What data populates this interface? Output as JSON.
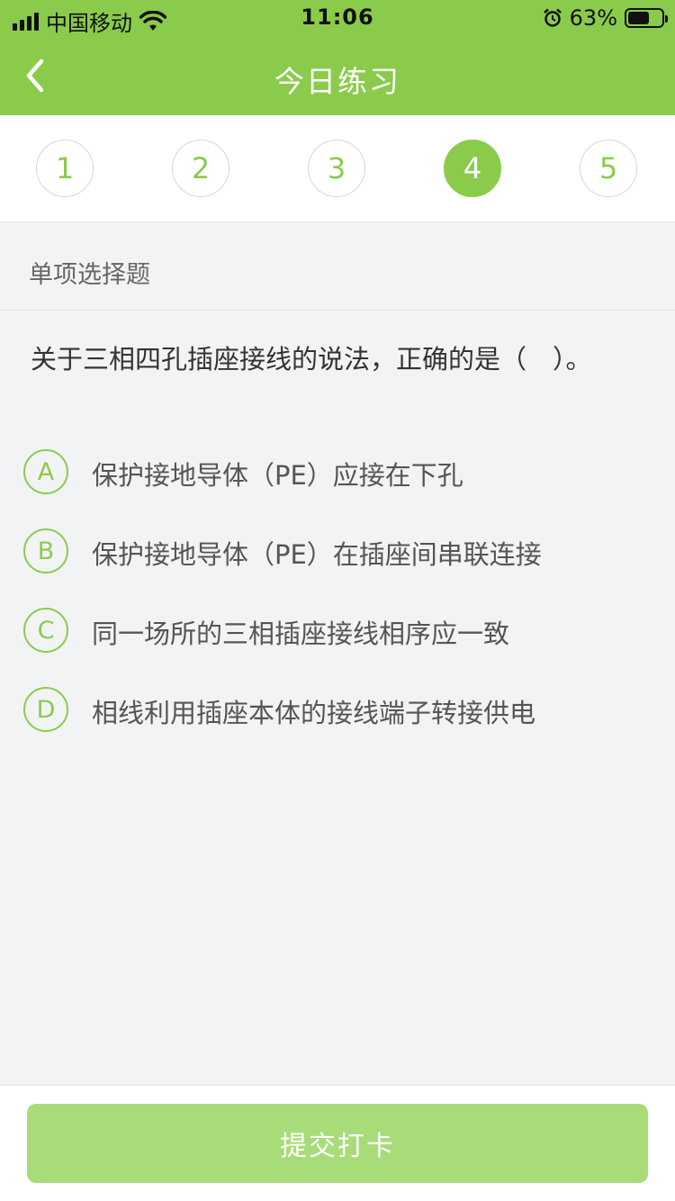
{
  "status_bar": {
    "carrier": "中国移动",
    "time": "11:06",
    "battery": "63%",
    "battery_level": 63,
    "icons": [
      "signal-icon",
      "wifi-icon",
      "alarm-icon",
      "battery-icon"
    ]
  },
  "nav": {
    "title": "今日练习",
    "back_icon": "chevron-left-icon"
  },
  "steps": {
    "items": [
      "1",
      "2",
      "3",
      "4",
      "5"
    ],
    "active": "4"
  },
  "question": {
    "type_label": "单项选择题",
    "text": "关于三相四孔插座接线的说法，正确的是（　）。",
    "options": [
      {
        "letter": "A",
        "text": "保护接地导体（PE）应接在下孔"
      },
      {
        "letter": "B",
        "text": "保护接地导体（PE）在插座间串联连接"
      },
      {
        "letter": "C",
        "text": "同一场所的三相插座接线相序应一致"
      },
      {
        "letter": "D",
        "text": "相线利用插座本体的接线端子转接供电"
      }
    ]
  },
  "footer": {
    "submit_label": "提交打卡"
  },
  "colors": {
    "brand_green": "#8bcb4b",
    "submit_button": "#a8dc79",
    "background": "#f2f3f5",
    "text_dark": "#333333",
    "text_muted": "#666666"
  }
}
